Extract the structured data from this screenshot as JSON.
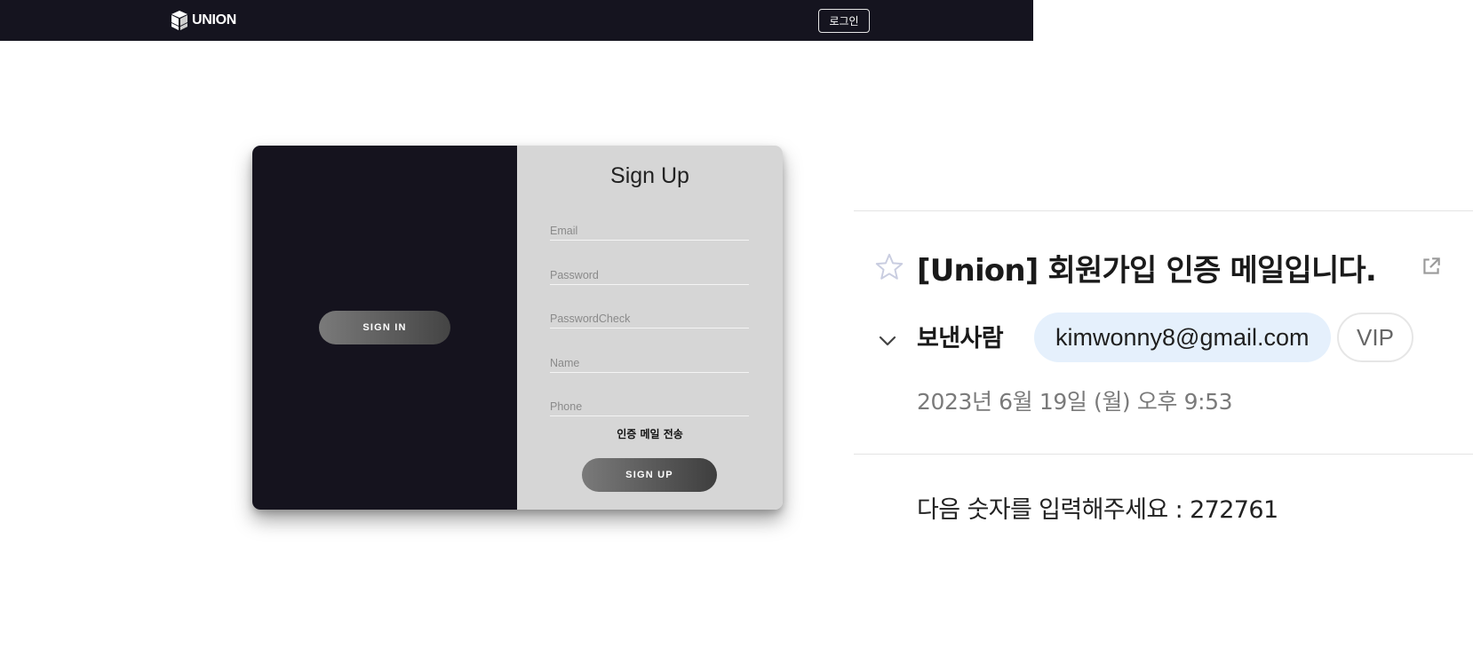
{
  "navbar": {
    "logo_text": "UNION",
    "login_label": "로그인",
    "logo_icon": "cube-stack-icon"
  },
  "signin": {
    "button_label": "SIGN IN"
  },
  "signup": {
    "title": "Sign Up",
    "fields": {
      "email": {
        "placeholder": "Email",
        "value": ""
      },
      "password": {
        "placeholder": "Password",
        "value": ""
      },
      "password_check": {
        "placeholder": "PasswordCheck",
        "value": ""
      },
      "name": {
        "placeholder": "Name",
        "value": ""
      },
      "phone": {
        "placeholder": "Phone",
        "value": ""
      }
    },
    "send_mail_label": "인증 메일 전송",
    "button_label": "SIGN UP"
  },
  "mail": {
    "subject": "[Union] 회원가입 인증 메일입니다.",
    "sender_label": "보낸사람",
    "sender_email": "kimwonny8@gmail.com",
    "vip_label": "VIP",
    "date": "2023년 6월 19일 (월) 오후 9:53",
    "body": "다음 숫자를 입력해주세요 : 272761",
    "icons": [
      "star-icon",
      "external-link-icon",
      "chevron-down-icon"
    ]
  },
  "colors": {
    "navbar_bg": "#15141f",
    "card_left_bg": "#15131e",
    "card_right_bg": "#d6d6d6",
    "sender_chip_bg": "#e5f0fc"
  }
}
